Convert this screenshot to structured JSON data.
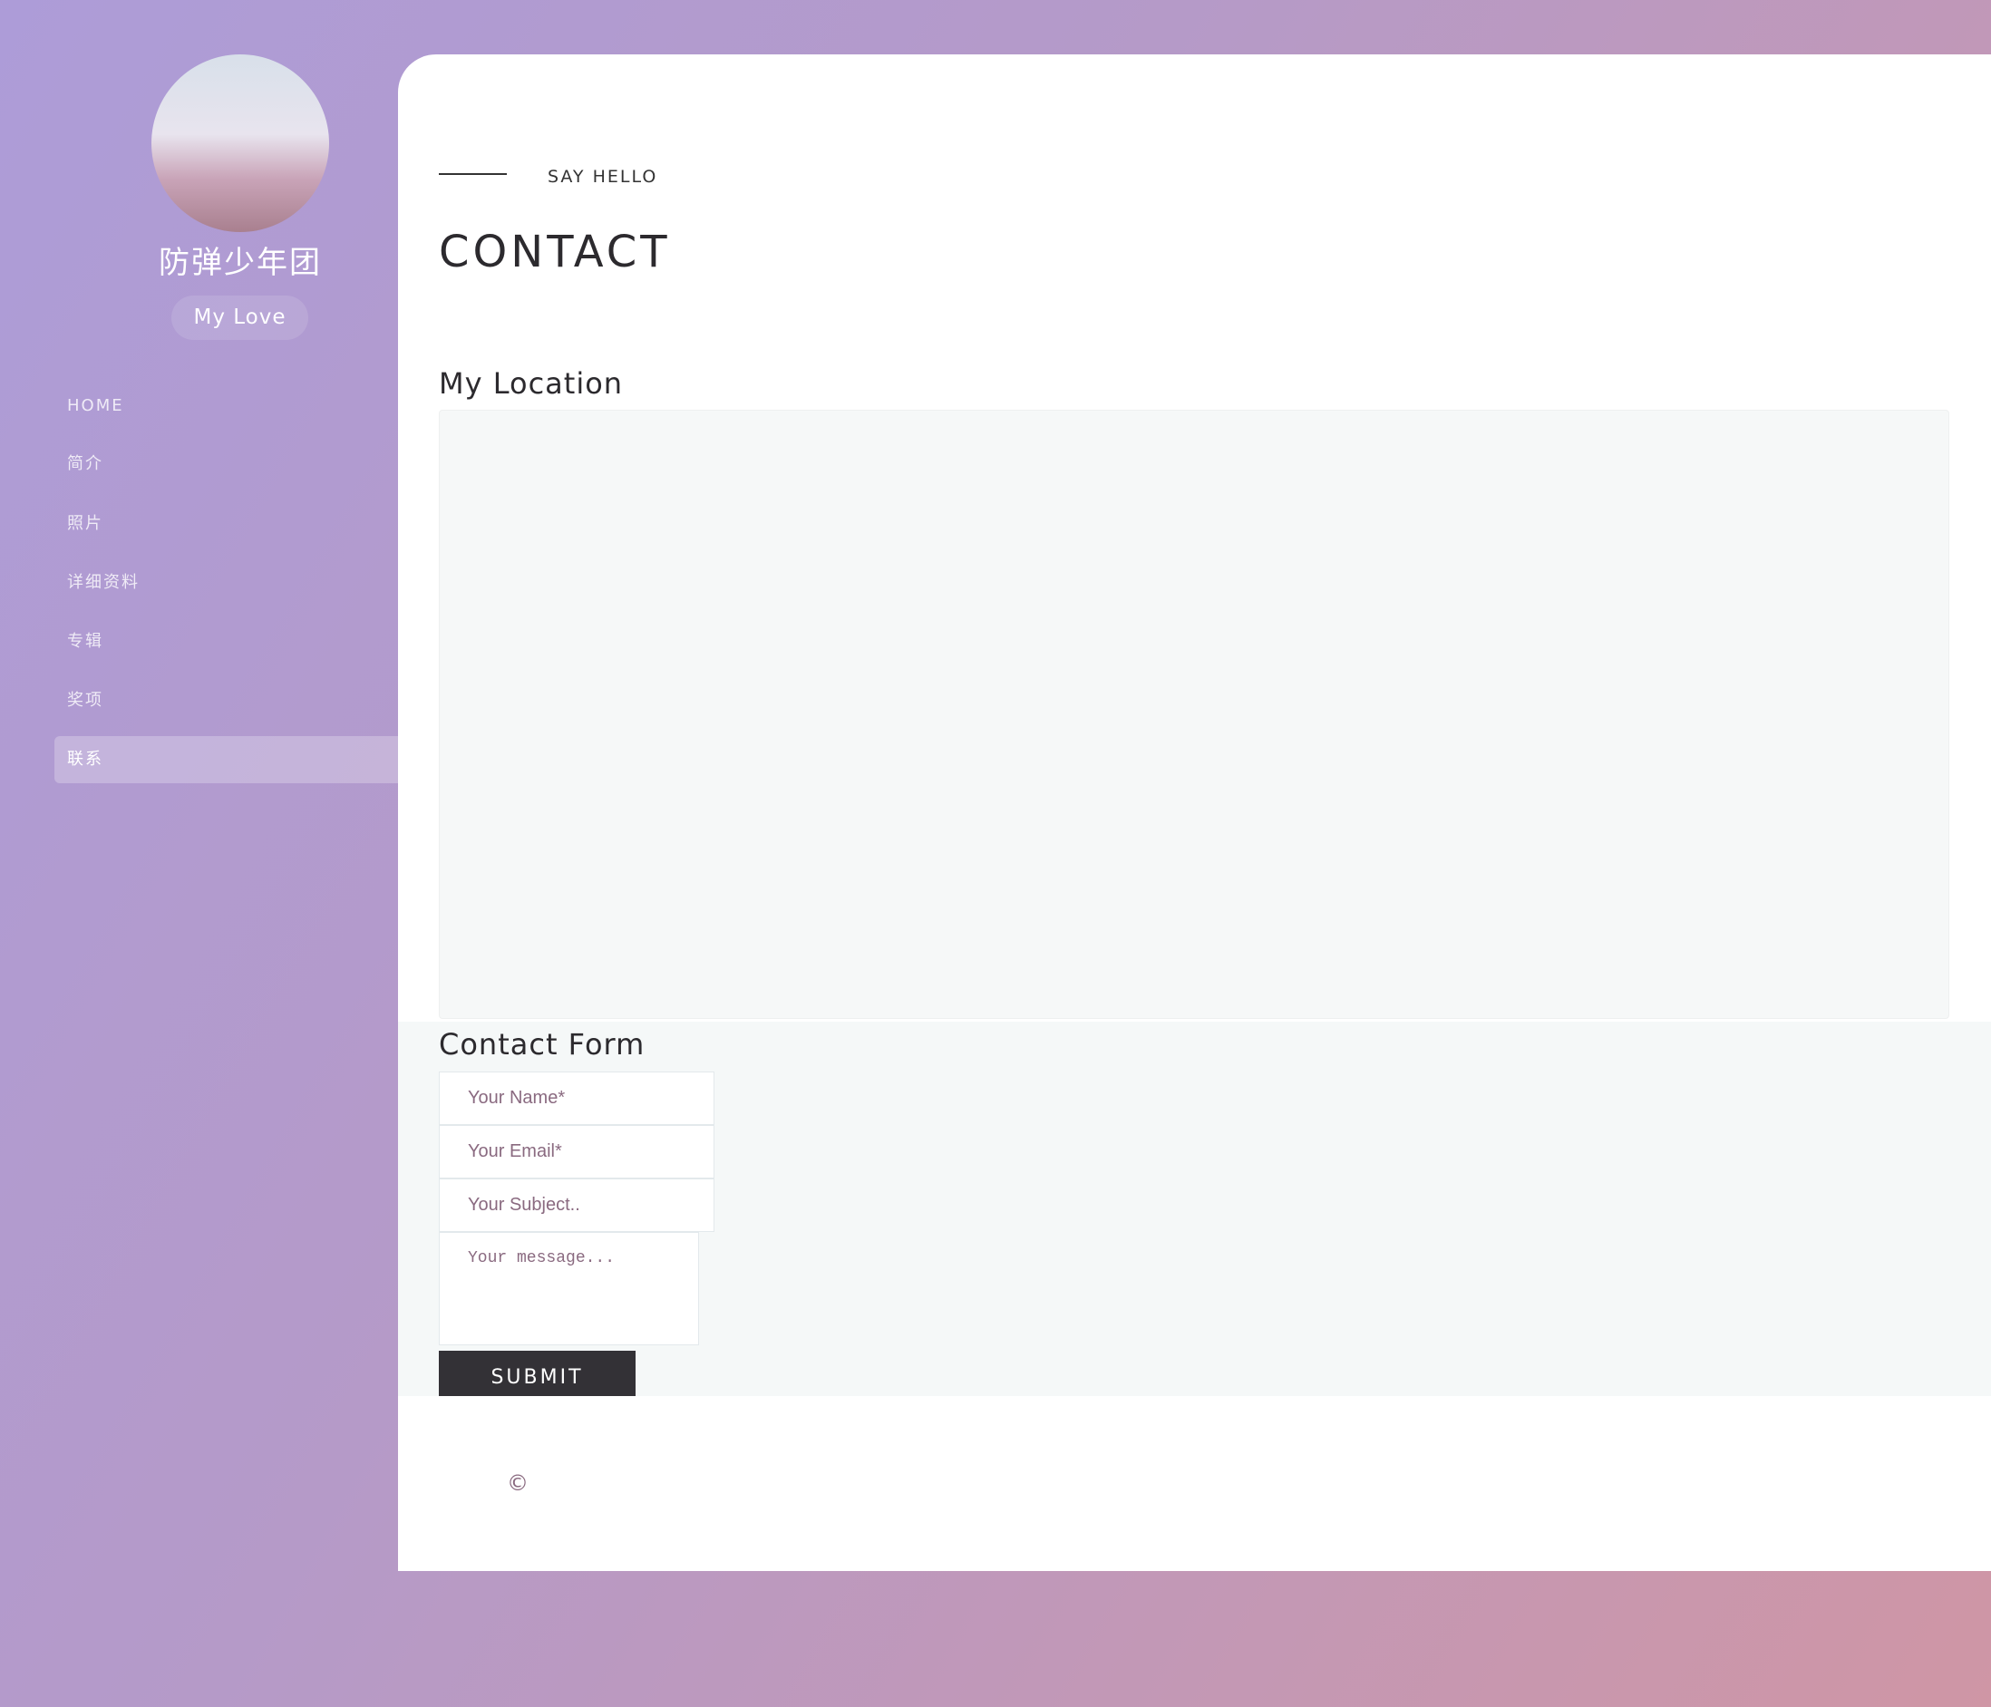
{
  "sidebar": {
    "title": "防弹少年团",
    "tagline": "My Love",
    "nav": [
      {
        "label": "HOME"
      },
      {
        "label": "简介"
      },
      {
        "label": "照片"
      },
      {
        "label": "详细资料"
      },
      {
        "label": "专辑"
      },
      {
        "label": "奖项"
      },
      {
        "label": "联系",
        "active": true
      }
    ]
  },
  "main": {
    "eyebrow": "SAY HELLO",
    "title": "CONTACT",
    "location_heading": "My Location",
    "form": {
      "heading": "Contact Form",
      "name_placeholder": "Your Name*",
      "email_placeholder": "Your Email*",
      "subject_placeholder": "Your Subject..",
      "message_placeholder": "Your message...",
      "submit_label": "SUBMIT"
    },
    "footer": {
      "copyright": "©"
    }
  },
  "colors": {
    "accent_dark": "#333136",
    "gradient_start": "#ad9cd8",
    "gradient_end": "#cf96a5"
  }
}
